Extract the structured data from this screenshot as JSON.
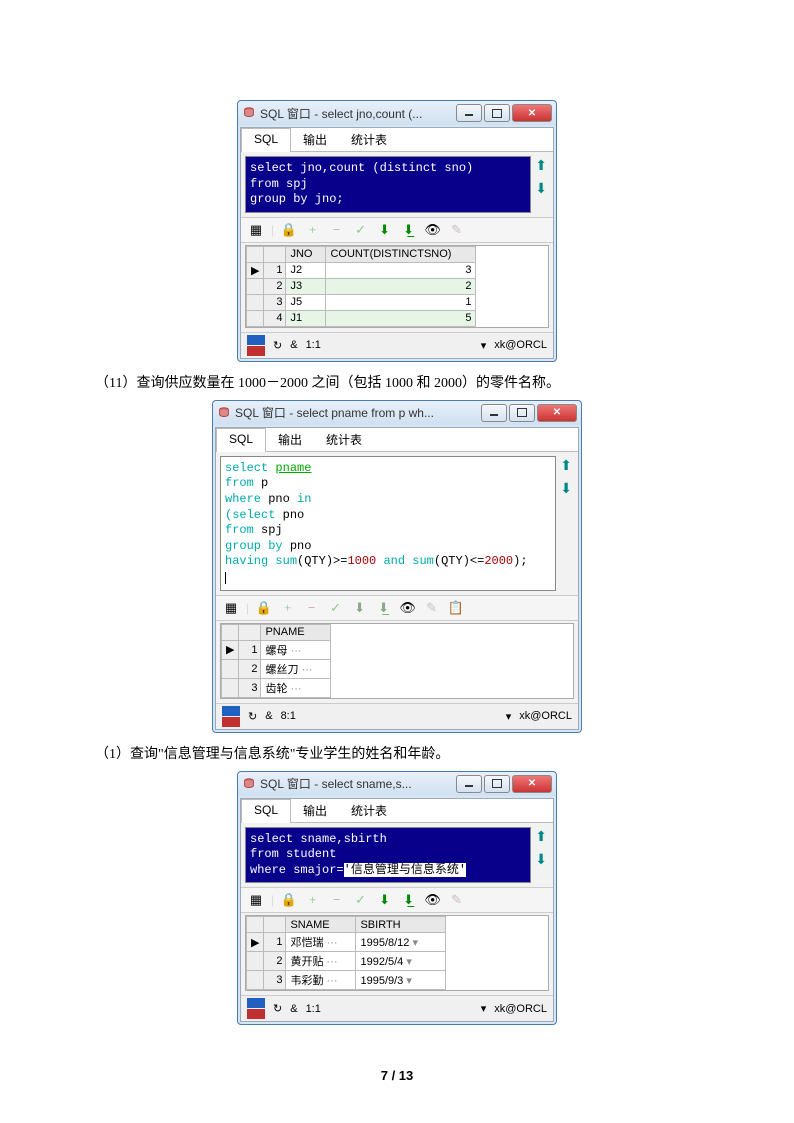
{
  "win1": {
    "title": "SQL 窗口 - select jno,count (...",
    "tabs": {
      "sql": "SQL",
      "output": "输出",
      "stats": "统计表"
    },
    "sql_line1": "select jno,count (distinct sno)",
    "sql_line2": "from spj",
    "sql_line3": "group by jno;",
    "cols": {
      "c1": "JNO",
      "c2": "COUNT(DISTINCTSNO)"
    },
    "rows": [
      {
        "n": "1",
        "jno": "J2",
        "cnt": "3"
      },
      {
        "n": "2",
        "jno": "J3",
        "cnt": "2"
      },
      {
        "n": "3",
        "jno": "J5",
        "cnt": "1"
      },
      {
        "n": "4",
        "jno": "J1",
        "cnt": "5"
      }
    ],
    "status_ratio": "1:1",
    "status_conn": "xk@ORCL"
  },
  "q11": "（11）查询供应数量在 1000－2000 之间（包括 1000 和 2000）的零件名称。",
  "win2": {
    "title": "SQL 窗口 - select pname from p wh...",
    "tabs": {
      "sql": "SQL",
      "output": "输出",
      "stats": "统计表"
    },
    "sql": {
      "l1a": "select",
      "l1b": "pname",
      "l2a": "from",
      "l2b": "p",
      "l3a": "where",
      "l3b": "pno",
      "l3c": "in",
      "l4a": "(select",
      "l4b": "pno",
      "l5a": "from",
      "l5b": "spj",
      "l6a": "group by",
      "l6b": "pno",
      "l7a": "having",
      "l7b": "sum",
      "l7c": "(QTY)>=",
      "l7d": "1000",
      "l7e": "and",
      "l7f": "sum",
      "l7g": "(QTY)<=",
      "l7h": "2000",
      "l7i": ");"
    },
    "col": "PNAME",
    "rows": [
      {
        "n": "1",
        "v": "螺母"
      },
      {
        "n": "2",
        "v": "螺丝刀"
      },
      {
        "n": "3",
        "v": "齿轮"
      }
    ],
    "status_ratio": "8:1",
    "status_conn": "xk@ORCL"
  },
  "q1": "（1）查询\"信息管理与信息系统\"专业学生的姓名和年龄。",
  "win3": {
    "title": "SQL 窗口 - select sname,s...",
    "tabs": {
      "sql": "SQL",
      "output": "输出",
      "stats": "统计表"
    },
    "sql_line1": "select sname,sbirth",
    "sql_line2": "from student",
    "sql_line3a": "where smajor=",
    "sql_line3b": "'信息管理与信息系统'",
    "cols": {
      "c1": "SNAME",
      "c2": "SBIRTH"
    },
    "rows": [
      {
        "n": "1",
        "name": "邓恺瑞",
        "birth": "1995/8/12"
      },
      {
        "n": "2",
        "name": "黄开贴",
        "birth": "1992/5/4"
      },
      {
        "n": "3",
        "name": "韦彩勤",
        "birth": "1995/9/3"
      }
    ],
    "status_ratio": "1:1",
    "status_conn": "xk@ORCL"
  },
  "page": {
    "cur": "7",
    "sep": " / ",
    "total": "13"
  }
}
